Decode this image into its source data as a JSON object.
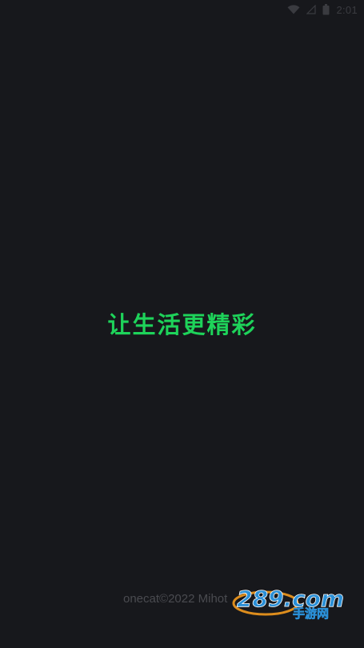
{
  "status_bar": {
    "time": "2:01",
    "icons": [
      "wifi-icon",
      "signal-icon",
      "battery-icon"
    ]
  },
  "splash": {
    "slogan": "让生活更精彩",
    "copyright": "onecat©2022 Mihot"
  },
  "watermark": {
    "logo_text": "289.com",
    "tagline": "手游网"
  },
  "colors": {
    "background": "#17181c",
    "slogan": "#1ed35a",
    "copyright": "#4a4b50",
    "watermark_orange": "#f39a1e",
    "watermark_blue": "#2a8fd6"
  }
}
